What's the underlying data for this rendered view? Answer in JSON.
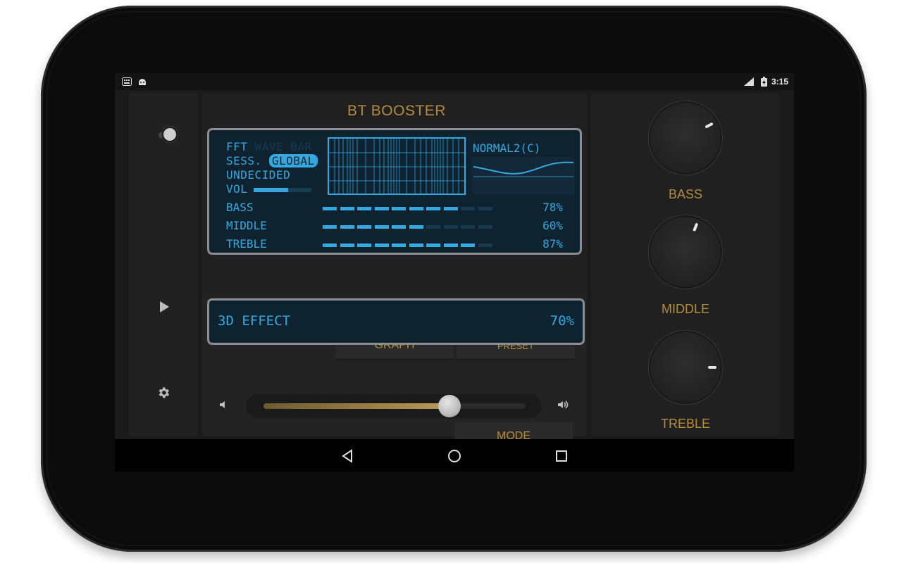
{
  "statusbar": {
    "time": "3:15",
    "left_icons": [
      "keyboard-icon",
      "android-icon"
    ],
    "right_icons": [
      "lte-signal-icon",
      "battery-charging-icon"
    ]
  },
  "app": {
    "title": "BT BOOSTER",
    "accent_color": "#b48c3c",
    "lcd_color": "#35a9df"
  },
  "rail": {
    "icons": [
      "power-toggle",
      "play-icon",
      "gear-icon"
    ]
  },
  "lcd": {
    "fft_label": "FFT",
    "wave_bar_label": "WAVE BAR",
    "sess_label": "SESS.",
    "session_value": "GLOBAL",
    "status": "UNDECIDED",
    "vol_label": "VOL",
    "vol_level": 0.6,
    "preset_name": "NORMAL2(C)",
    "bands": [
      {
        "label": "BASS",
        "percent_text": "78%",
        "value": 78
      },
      {
        "label": "MIDDLE",
        "percent_text": "60%",
        "value": 60
      },
      {
        "label": "TREBLE",
        "percent_text": "87%",
        "value": 87
      }
    ]
  },
  "buttons": {
    "graph": "GRAPH",
    "preset": "PRESET",
    "mode": "MODE"
  },
  "effect": {
    "label": "3D EFFECT",
    "percent_text": "70%"
  },
  "volume_slider": {
    "level": 0.71
  },
  "knobs": [
    {
      "label": "BASS",
      "angle": 62
    },
    {
      "label": "MIDDLE",
      "angle": 22
    },
    {
      "label": "TREBLE",
      "angle": 90
    }
  ]
}
